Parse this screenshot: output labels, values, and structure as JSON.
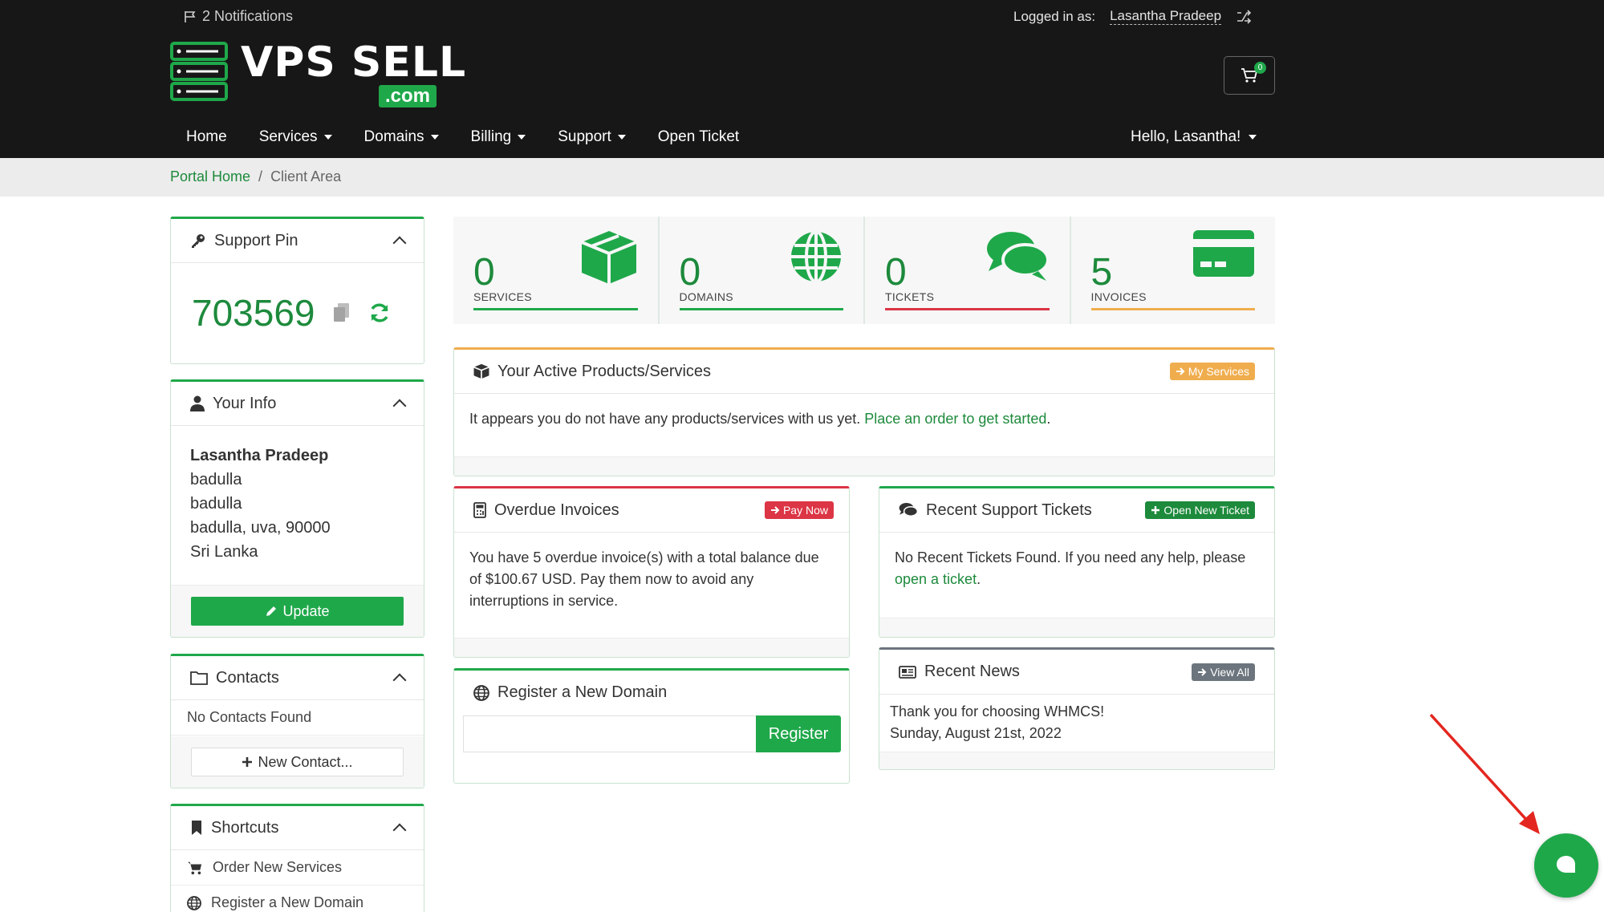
{
  "topbar": {
    "notifications": "2 Notifications",
    "logged_in_label": "Logged in as:",
    "user_name": "Lasantha Pradeep",
    "logo_main": "VPS SELL",
    "logo_com": ".com",
    "cart_count": "0",
    "hello": "Hello, Lasantha!"
  },
  "nav": {
    "home": "Home",
    "services": "Services",
    "domains": "Domains",
    "billing": "Billing",
    "support": "Support",
    "open_ticket": "Open Ticket"
  },
  "breadcrumb": {
    "home": "Portal Home",
    "separator": "/",
    "current": "Client Area"
  },
  "support_pin": {
    "title": "Support Pin",
    "value": "703569"
  },
  "your_info": {
    "title": "Your Info",
    "name": "Lasantha Pradeep",
    "line1": "badulla",
    "line2": "badulla",
    "line3": "badulla, uva, 90000",
    "country": "Sri Lanka",
    "update_label": "Update"
  },
  "contacts": {
    "title": "Contacts",
    "empty": "No Contacts Found",
    "new_label": "New Contact..."
  },
  "shortcuts": {
    "title": "Shortcuts",
    "items": [
      "Order New Services",
      "Register a New Domain"
    ]
  },
  "stats": {
    "services": {
      "count": "0",
      "label": "SERVICES"
    },
    "domains": {
      "count": "0",
      "label": "DOMAINS"
    },
    "tickets": {
      "count": "0",
      "label": "TICKETS"
    },
    "invoices": {
      "count": "5",
      "label": "INVOICES"
    }
  },
  "active_products": {
    "title": "Your Active Products/Services",
    "button": "My Services",
    "message": "It appears you do not have any products/services with us yet.",
    "link": "Place an order to get started",
    "period": "."
  },
  "overdue": {
    "title": "Overdue Invoices",
    "button": "Pay Now",
    "message": "You have 5 overdue invoice(s) with a total balance due of $100.67 USD. Pay them now to avoid any interruptions in service."
  },
  "tickets": {
    "title": "Recent Support Tickets",
    "button": "Open New Ticket",
    "message": "No Recent Tickets Found. If you need any help, please",
    "link": "open a ticket",
    "period": "."
  },
  "register_domain": {
    "title": "Register a New Domain",
    "placeholder": "",
    "button": "Register"
  },
  "news": {
    "title": "Recent News",
    "button": "View All",
    "item": "Thank you for choosing WHMCS!",
    "date": "Sunday, August 21st, 2022"
  },
  "colors": {
    "brand_green": "#1fa84a",
    "dark_bar": "#171717",
    "orange": "#f0ad4e",
    "red": "#dc3545",
    "grey": "#6c757d"
  }
}
